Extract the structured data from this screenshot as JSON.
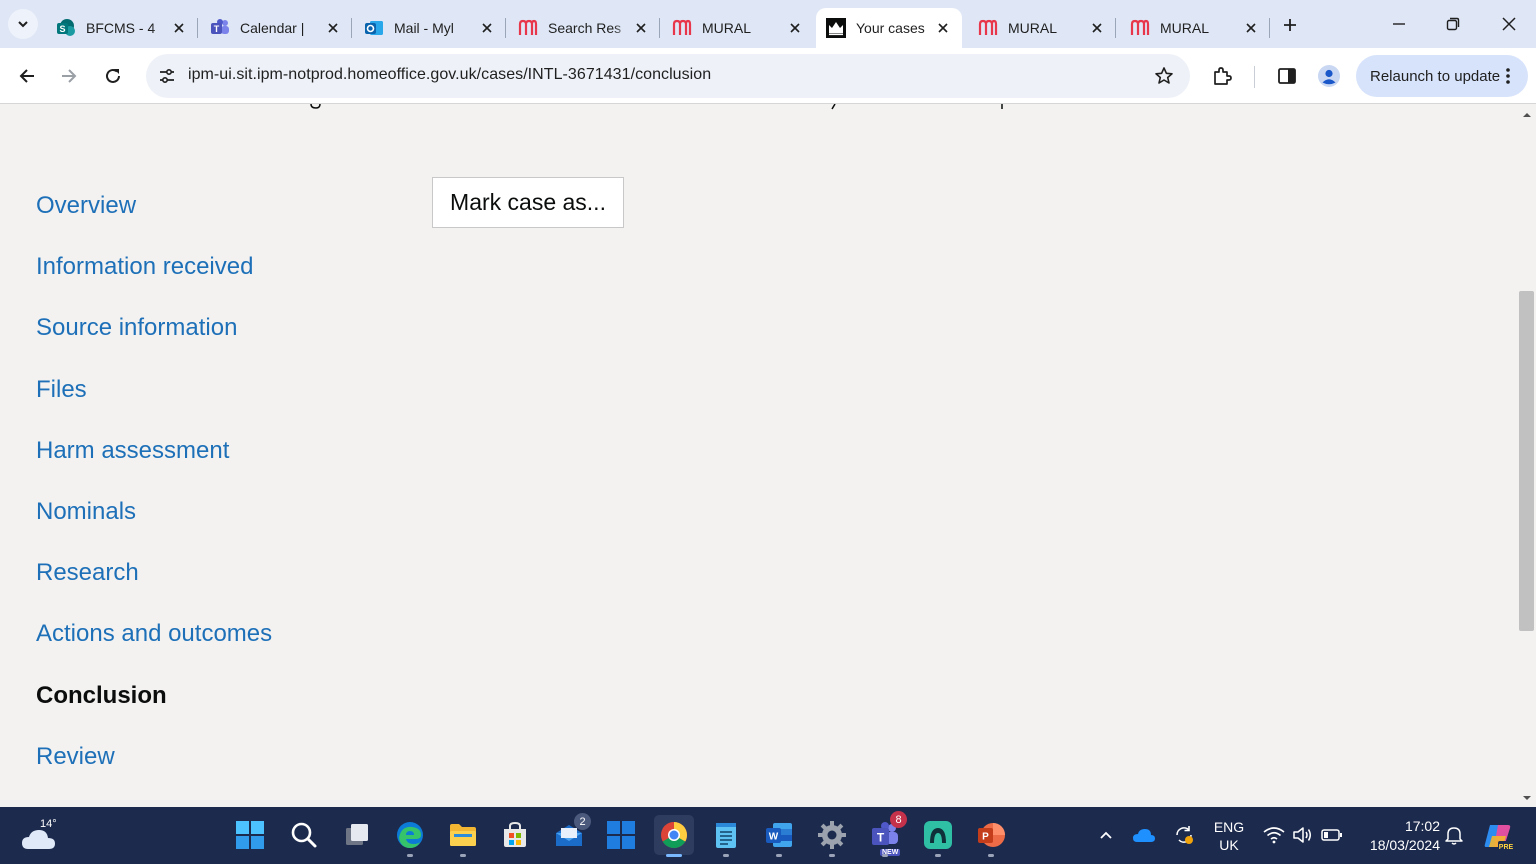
{
  "browser": {
    "tabs": [
      {
        "title": "BFCMS - 4",
        "favicon": "sharepoint-icon",
        "active": false
      },
      {
        "title": "Calendar |",
        "favicon": "teams-icon",
        "active": false
      },
      {
        "title": "Mail - Myl",
        "favicon": "outlook-icon",
        "active": false
      },
      {
        "title": "Search Res",
        "favicon": "mural-icon",
        "active": false
      },
      {
        "title": "MURAL",
        "favicon": "mural-icon",
        "active": false
      },
      {
        "title": "Your cases",
        "favicon": "crown-icon",
        "active": true
      },
      {
        "title": "MURAL",
        "favicon": "mural-icon",
        "active": false
      },
      {
        "title": "MURAL",
        "favicon": "mural-icon",
        "active": false
      }
    ],
    "url": "ipm-ui.sit.ipm-notprod.homeoffice.gov.uk/cases/INTL-3671431/conclusion",
    "relaunch_label": "Relaunch to update"
  },
  "page": {
    "action_button": "Mark case as...",
    "nav": [
      {
        "label": "Overview",
        "current": false
      },
      {
        "label": "Information received",
        "current": false
      },
      {
        "label": "Source information",
        "current": false
      },
      {
        "label": "Files",
        "current": false
      },
      {
        "label": "Harm assessment",
        "current": false
      },
      {
        "label": "Nominals",
        "current": false
      },
      {
        "label": "Research",
        "current": false
      },
      {
        "label": "Actions and outcomes",
        "current": false
      },
      {
        "label": "Conclusion",
        "current": true
      },
      {
        "label": "Review",
        "current": false
      }
    ]
  },
  "taskbar": {
    "weather_temp": "14°",
    "mail_badge": "2",
    "teams_badge": "8",
    "teams_tag": "NEW",
    "language": "ENG",
    "region": "UK",
    "time": "17:02",
    "date": "18/03/2024"
  },
  "colors": {
    "link": "#1d70b8",
    "text": "#0b0c0c",
    "page_bg": "#f3f2f1",
    "tabstrip_bg": "#dfe7f6",
    "taskbar_bg": "#1c2a4d",
    "relaunch_bg": "#d7e3fb"
  }
}
